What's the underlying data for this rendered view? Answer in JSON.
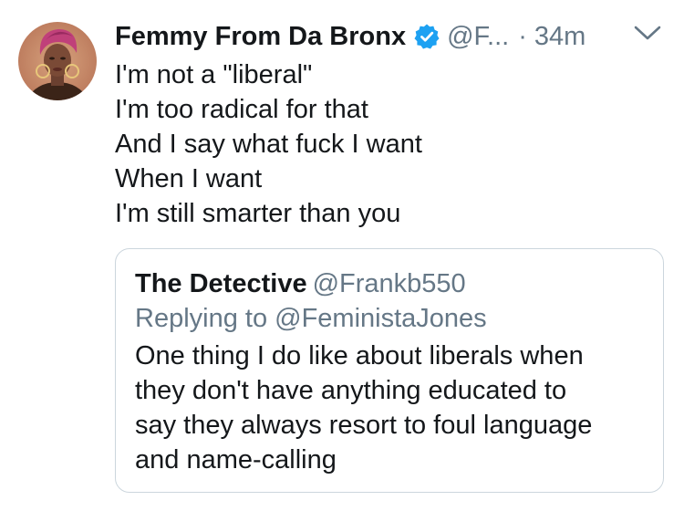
{
  "tweet": {
    "display_name": "Femmy From Da Bronx",
    "handle": "@F...",
    "separator": "·",
    "time": "34m",
    "verified_icon": "verified-badge-icon",
    "menu_icon": "chevron-down-icon",
    "lines": [
      "I'm not a \"liberal\"",
      "I'm too radical for that",
      "And I say what fuck I want",
      "When I want",
      "I'm still smarter than you"
    ]
  },
  "quoted_tweet": {
    "display_name": "The Detective",
    "handle": "@Frankb550",
    "replying_to": "Replying to @FeministaJones",
    "lines": [
      "One thing I do like about liberals when",
      "they don't have anything educated to",
      "say they always resort to foul language",
      "and name-calling"
    ]
  },
  "colors": {
    "text": "#14171a",
    "secondary": "#657786",
    "verified_blue": "#1da1f2",
    "border": "#ccd6dd"
  }
}
